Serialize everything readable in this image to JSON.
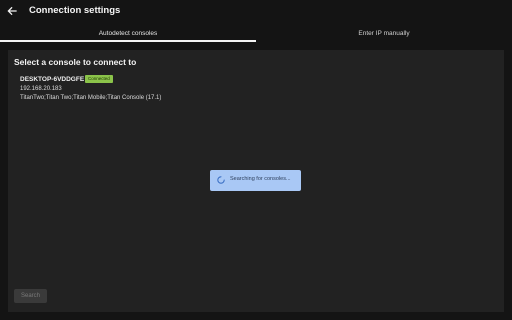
{
  "header": {
    "title": "Connection settings",
    "back_icon": "arrow-back-icon"
  },
  "tabs": [
    {
      "label": "Autodetect consoles",
      "active": true
    },
    {
      "label": "Enter IP manually",
      "active": false
    }
  ],
  "panel": {
    "heading": "Select a console to connect to",
    "consoles": [
      {
        "name": "DESKTOP-6VDDGFE",
        "status": "Connected",
        "ip": "192.168.20.183",
        "apps": "TitanTwo;Titan Two;Titan Mobile;Titan Console (17.1)"
      }
    ],
    "searching_text": "Searching for consoles...",
    "search_button": "Search"
  },
  "colors": {
    "background": "#141414",
    "panel": "#222222",
    "badge": "#8bc34a",
    "toast": "#a9c8f5",
    "tab_underline": "#f4f4f4"
  }
}
